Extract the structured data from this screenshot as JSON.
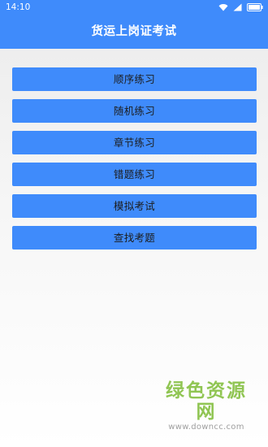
{
  "status_bar": {
    "time": "14:10"
  },
  "app_bar": {
    "title": "货运上岗证考试"
  },
  "menu": {
    "items": [
      {
        "label": "顺序练习"
      },
      {
        "label": "随机练习"
      },
      {
        "label": "章节练习"
      },
      {
        "label": "错题练习"
      },
      {
        "label": "模拟考试"
      },
      {
        "label": "查找考题"
      }
    ]
  },
  "watermark": {
    "main": "绿色资源网",
    "sub": "www.downcc.com"
  },
  "colors": {
    "primary": "#3f8bfb",
    "watermark_green": "#8bc34a"
  }
}
